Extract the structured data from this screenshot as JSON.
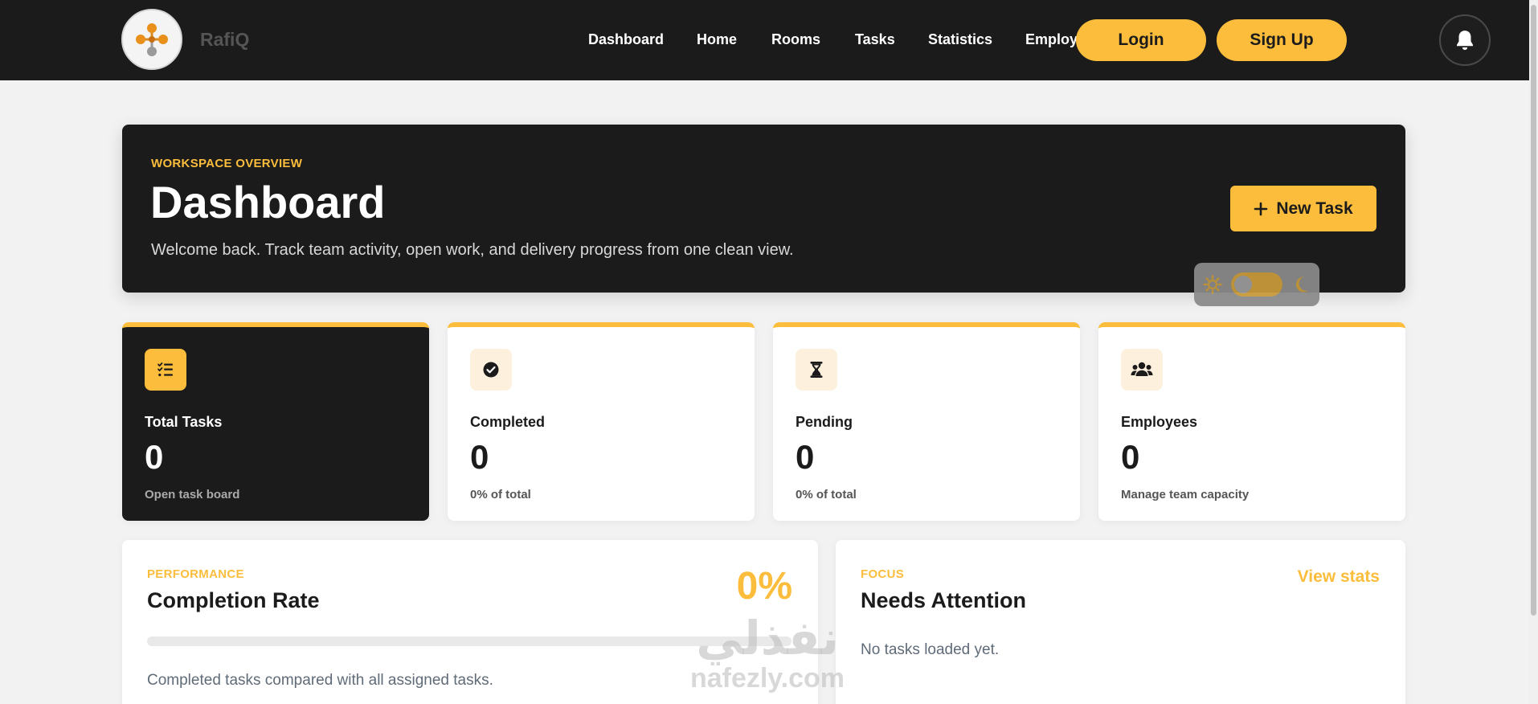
{
  "navbar": {
    "brand": "RafiQ",
    "logo_icon": "network-nodes-icon",
    "links": [
      "Dashboard",
      "Home",
      "Rooms",
      "Tasks",
      "Statistics",
      "Employ"
    ],
    "login_label": "Login",
    "signup_label": "Sign Up",
    "bell_icon": "bell-icon"
  },
  "hero": {
    "eyebrow": "WORKSPACE OVERVIEW",
    "title": "Dashboard",
    "subtitle": "Welcome back. Track team activity, open work, and delivery progress from one clean view.",
    "new_task_label": "New Task",
    "new_task_icon": "plus-icon",
    "theme_toggle": {
      "light_icon": "sun-icon",
      "dark_icon": "moon-icon",
      "mode": "light"
    }
  },
  "stats": [
    {
      "icon": "checklist-icon",
      "label": "Total Tasks",
      "value": "0",
      "note": "Open task board"
    },
    {
      "icon": "check-circle-icon",
      "label": "Completed",
      "value": "0",
      "note": "0% of total"
    },
    {
      "icon": "hourglass-icon",
      "label": "Pending",
      "value": "0",
      "note": "0% of total"
    },
    {
      "icon": "users-icon",
      "label": "Employees",
      "value": "0",
      "note": "Manage team capacity"
    }
  ],
  "performance": {
    "eyebrow": "PERFORMANCE",
    "title": "Completion Rate",
    "rate": "0%",
    "progress_fraction": 0,
    "caption": "Completed tasks compared with all assigned tasks."
  },
  "focus": {
    "eyebrow": "FOCUS",
    "title": "Needs Attention",
    "view_link": "View stats",
    "empty_text": "No tasks loaded yet."
  },
  "watermark": {
    "arabic": "نفذلي",
    "latin": "nafezly.com"
  },
  "colors": {
    "accent": "#fbbd3b",
    "dark": "#1b1b1b",
    "page_bg": "#f2f2f2"
  }
}
